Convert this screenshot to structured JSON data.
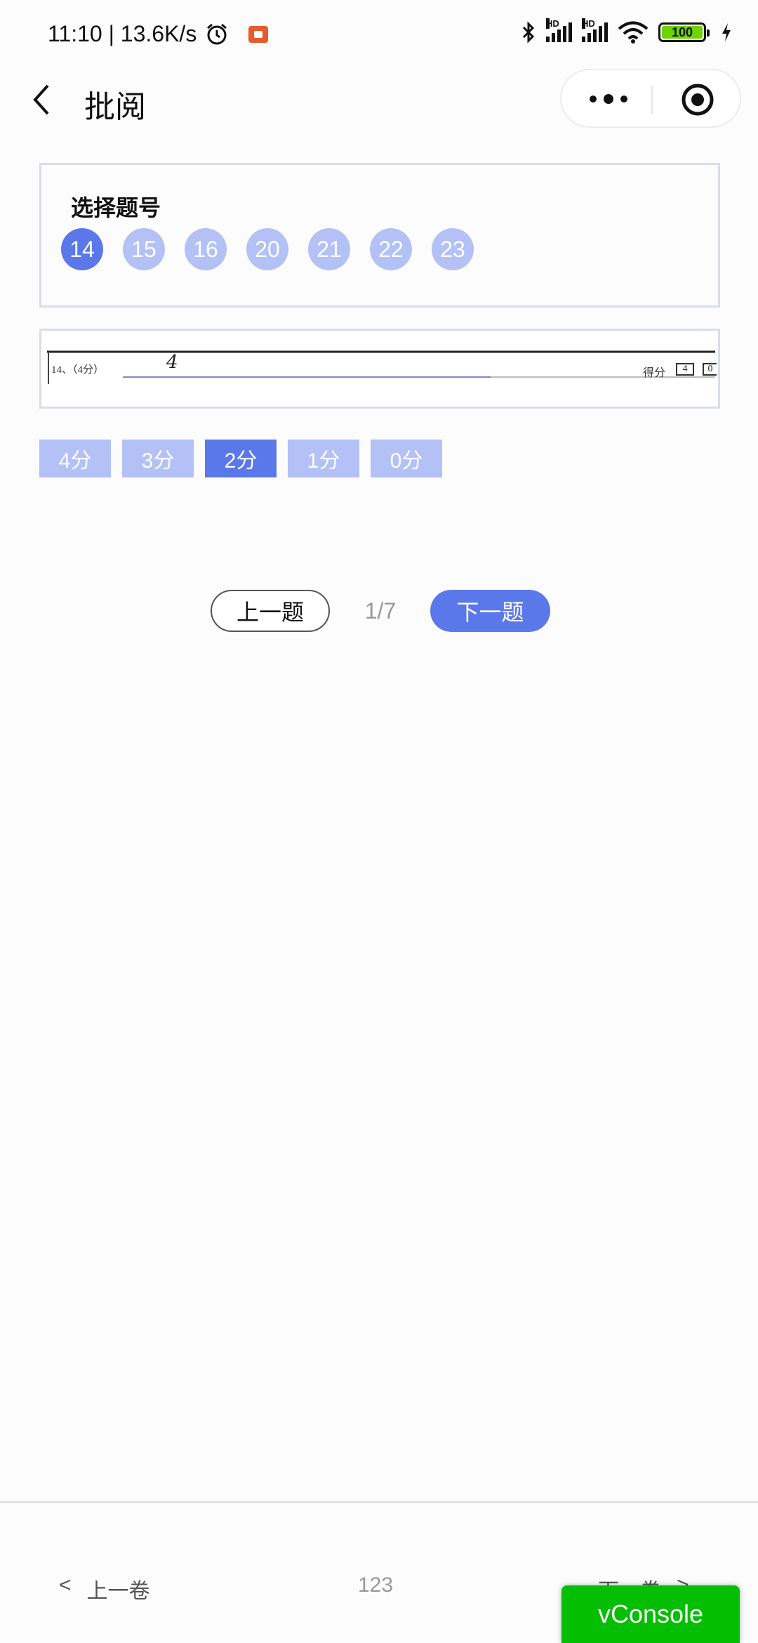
{
  "status_bar": {
    "time_speed": "11:10 | 13.6K/s",
    "battery": "100",
    "hd1": "HD",
    "hd2": "HD"
  },
  "nav": {
    "title": "批阅"
  },
  "question_select": {
    "title": "选择题号",
    "numbers": [
      "14",
      "15",
      "16",
      "20",
      "21",
      "22",
      "23"
    ],
    "selected": "14"
  },
  "answer": {
    "question_label": "14、（4分）",
    "handwritten_answer": "4",
    "score_label": "得分",
    "score_value": "4",
    "score_value2": "0"
  },
  "scores": {
    "options": [
      "4分",
      "3分",
      "2分",
      "1分",
      "0分"
    ],
    "selected": "2分"
  },
  "pager": {
    "prev_label": "上一题",
    "indicator": "1/7",
    "next_label": "下一题"
  },
  "bottom": {
    "prev_arrow": "<",
    "prev_label": "上一卷",
    "paper_id": "123",
    "next_label": "下一卷",
    "next_arrow": ">"
  },
  "vconsole": {
    "label": "vConsole"
  },
  "colors": {
    "accent": "#5b78ea",
    "accent_light": "#b3c1f7",
    "vconsole_green": "#04be02"
  }
}
